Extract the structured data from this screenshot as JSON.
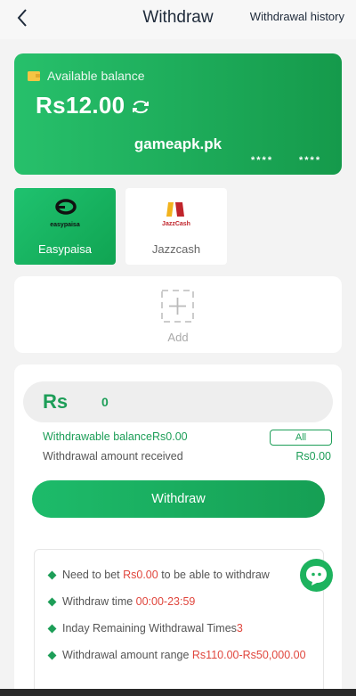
{
  "header": {
    "title": "Withdraw",
    "history_label": "Withdrawal history"
  },
  "balance_card": {
    "label": "Available balance",
    "amount": "Rs12.00",
    "site": "gameapk.pk",
    "mask_1": "****",
    "mask_2": "****"
  },
  "methods": [
    {
      "label": "Easypaisa",
      "logo_text": "easypaisa",
      "selected": true
    },
    {
      "label": "Jazzcash",
      "logo_text": "JazzCash",
      "selected": false
    }
  ],
  "add_card": {
    "label": "Add"
  },
  "form": {
    "currency": "Rs",
    "amount_value": "0",
    "withdrawable_label": "Withdrawable balanceRs0.00",
    "all_label": "All",
    "received_label": "Withdrawal amount received",
    "received_value": "Rs0.00",
    "withdraw_button": "Withdraw"
  },
  "rules": {
    "r1_prefix": "Need to bet ",
    "r1_amount": "Rs0.00",
    "r1_suffix": " to be able to withdraw",
    "r2_prefix": "Withdraw time ",
    "r2_time": "00:00-23:59",
    "r3_prefix": "Inday Remaining Withdrawal Times",
    "r3_count": "3",
    "r4_prefix": "Withdrawal amount range ",
    "r4_range": "Rs110.00-Rs50,000.00"
  },
  "colors": {
    "accent": "#1d9e58",
    "highlight": "#e0463d"
  }
}
